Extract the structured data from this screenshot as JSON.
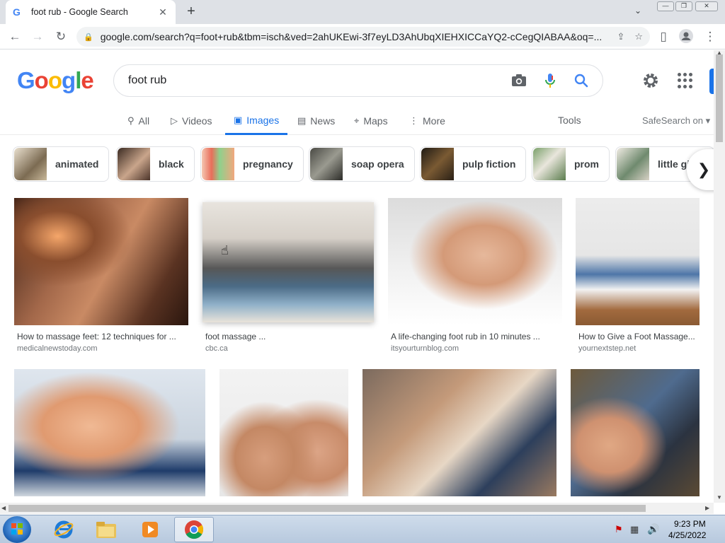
{
  "browser": {
    "tab_title": "foot rub - Google Search",
    "new_tab": "+",
    "url": "google.com/search?q=foot+rub&tbm=isch&ved=2ahUKEwi-3f7eyLD3AhUbqXIEHXICCaYQ2-cCegQIABAA&oq=..."
  },
  "search": {
    "query": "foot rub"
  },
  "nav_tabs": [
    {
      "label": "All"
    },
    {
      "label": "Videos"
    },
    {
      "label": "Images"
    },
    {
      "label": "News"
    },
    {
      "label": "Maps"
    },
    {
      "label": "More"
    }
  ],
  "tools_label": "Tools",
  "safesearch_label": "SafeSearch on ▾",
  "chips": [
    {
      "label": "animated"
    },
    {
      "label": "black"
    },
    {
      "label": "pregnancy"
    },
    {
      "label": "soap opera"
    },
    {
      "label": "pulp fiction"
    },
    {
      "label": "prom"
    },
    {
      "label": "little gi"
    }
  ],
  "results_row1": [
    {
      "title": "How to massage feet: 12 techniques for ...",
      "source": "medicalnewstoday.com"
    },
    {
      "title": "foot massage ...",
      "source": "cbc.ca"
    },
    {
      "title": "A life-changing foot rub in 10 minutes ...",
      "source": "itsyourturnblog.com"
    },
    {
      "title": "How to Give a Foot Massage...",
      "source": "yournextstep.net"
    }
  ],
  "taskbar": {
    "time": "9:23 PM",
    "date": "4/25/2022"
  },
  "colors": {
    "accent": "#1a73e8",
    "google_blue": "#4285f4",
    "google_red": "#ea4335",
    "google_yellow": "#fbbc05",
    "google_green": "#34a853"
  }
}
